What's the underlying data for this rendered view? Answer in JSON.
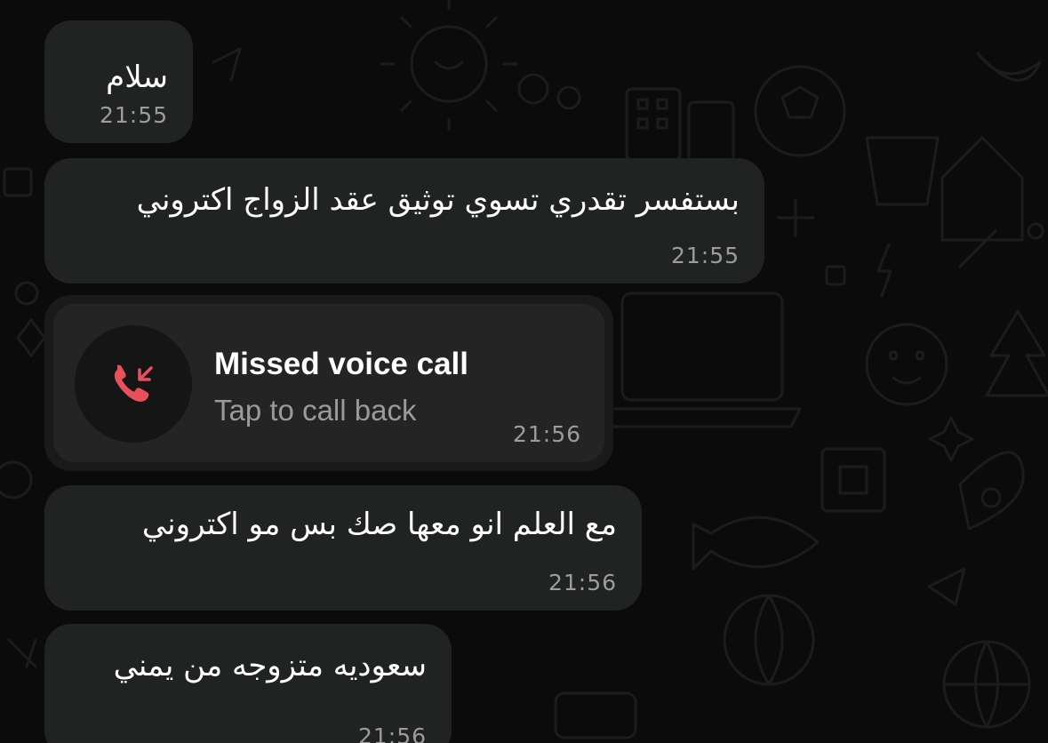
{
  "chat": {
    "messages": [
      {
        "text": "سلام",
        "time": "21:55"
      },
      {
        "text": "بستفسر تقدري تسوي توثيق عقد الزواج اكتروني",
        "time": "21:55"
      },
      {
        "text": "مع العلم انو معها صك بس مو اكتروني",
        "time": "21:56"
      },
      {
        "text": "سعوديه متزوجه من يمني",
        "time": "21:56"
      }
    ],
    "missed_call": {
      "title": "Missed voice call",
      "subtitle": "Tap to call back",
      "time": "21:56",
      "icon": "missed-call-icon"
    }
  },
  "colors": {
    "background": "#0b0b0b",
    "bubble": "#212222",
    "missed_call_accent": "#e8505b",
    "timestamp": "#9c9c9c"
  }
}
